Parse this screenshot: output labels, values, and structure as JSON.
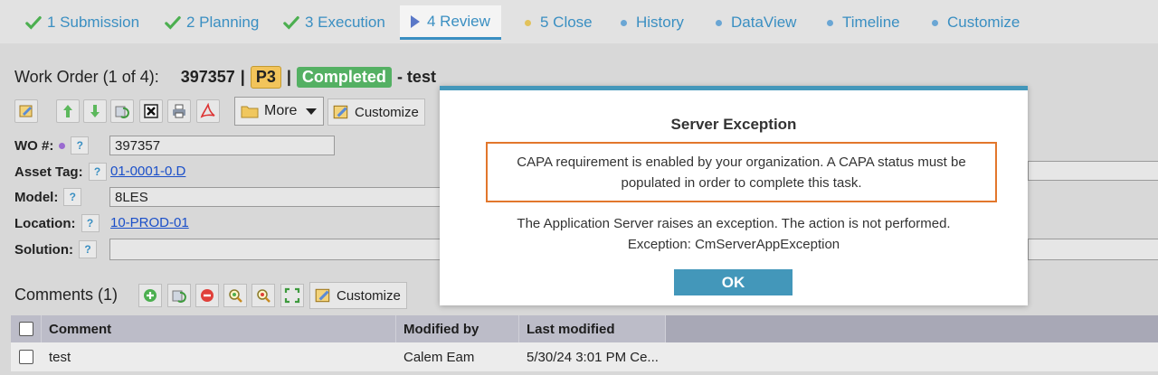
{
  "tabs": [
    {
      "label": "1 Submission",
      "icon": "check-icon"
    },
    {
      "label": "2 Planning",
      "icon": "check-icon"
    },
    {
      "label": "3 Execution",
      "icon": "check-icon"
    },
    {
      "label": "4 Review",
      "icon": "triangle-icon",
      "active": true
    },
    {
      "label": "5 Close",
      "icon": "yellow-dot-icon"
    },
    {
      "label": "History",
      "icon": "dot-icon"
    },
    {
      "label": "DataView",
      "icon": "dot-icon"
    },
    {
      "label": "Timeline",
      "icon": "dot-icon"
    },
    {
      "label": "Customize",
      "icon": "dot-icon"
    }
  ],
  "work_order": {
    "heading": "Work Order (1 of 4):",
    "number": "397357",
    "sep1": "|",
    "priority": "P3",
    "sep2": "|",
    "status": "Completed",
    "description": "- test"
  },
  "toolbar": {
    "more_label": "More",
    "customize_label": "Customize"
  },
  "form": {
    "wo_label": "WO #:",
    "wo_value": "397357",
    "asset_label": "Asset Tag:",
    "asset_value": "01-0001-0.D",
    "model_label": "Model:",
    "model_value": "8LES",
    "location_label": "Location:",
    "location_value": "10-PROD-01",
    "solution_label": "Solution:",
    "help_mark": "?"
  },
  "comments": {
    "title": "Comments (1)",
    "customize_label": "Customize",
    "columns": [
      "Comment",
      "Modified by",
      "Last modified"
    ],
    "rows": [
      {
        "comment": "test",
        "modified_by": "Calem Eam",
        "last_modified": "5/30/24 3:01 PM Ce..."
      }
    ]
  },
  "modal": {
    "title": "Server Exception",
    "highlight_line1": "CAPA requirement is enabled by your organization. A CAPA status must be",
    "highlight_line2": "populated in order to complete this task.",
    "message_line1": "The Application Server raises an exception. The action is not performed.",
    "message_line2": "Exception: CmServerAppException",
    "ok_label": "OK"
  },
  "colors": {
    "accent": "#4397ba",
    "highlight_border": "#e2772c",
    "completed": "#54b063",
    "priority": "#f2c45b",
    "link": "#1a4fc9"
  }
}
